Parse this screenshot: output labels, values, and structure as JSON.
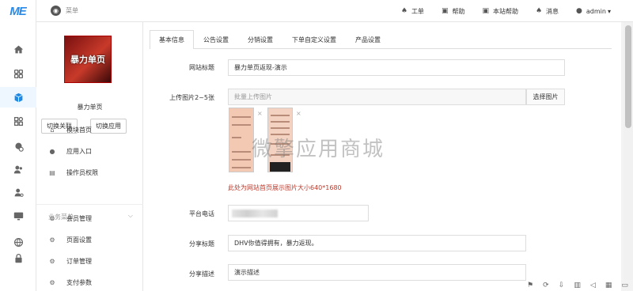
{
  "rail": {
    "logo": "ME",
    "items": [
      {
        "name": "home-icon",
        "glyph": "home"
      },
      {
        "name": "grid-icon",
        "glyph": "grid"
      },
      {
        "name": "cube-icon",
        "glyph": "cube",
        "active": true
      },
      {
        "name": "apps-icon",
        "glyph": "apps"
      },
      {
        "name": "layers-icon",
        "glyph": "layers"
      },
      {
        "name": "users-icon",
        "glyph": "users"
      },
      {
        "name": "user-settings-icon",
        "glyph": "user"
      },
      {
        "name": "monitor-icon",
        "glyph": "monitor"
      },
      {
        "name": "globe-icon",
        "glyph": "globe"
      },
      {
        "name": "lock-icon",
        "glyph": "lock"
      }
    ]
  },
  "topbar": {
    "menu_label": "菜单",
    "items": [
      {
        "name": "ticket",
        "label": "工单",
        "icon": "bell-icon"
      },
      {
        "name": "help",
        "label": "帮助",
        "icon": "book-icon"
      },
      {
        "name": "site-help",
        "label": "本站帮助",
        "icon": "book-icon"
      },
      {
        "name": "messages",
        "label": "消息",
        "icon": "bell-icon"
      },
      {
        "name": "user",
        "label": "admin",
        "icon": "user-icon"
      }
    ]
  },
  "sidebar": {
    "thumb_text": "暴力单页",
    "app_name": "暴力单页",
    "switch_link": "切换关联",
    "switch_app": "切换应用",
    "nav": [
      {
        "label": "模块首页",
        "icon": "home-icon"
      },
      {
        "label": "应用入口",
        "icon": "chat-icon"
      },
      {
        "label": "操作员权限",
        "icon": "document-icon"
      }
    ],
    "group_title": "业务菜单",
    "biz": [
      {
        "label": "会员管理",
        "icon": "gear-icon"
      },
      {
        "label": "页面设置",
        "icon": "gear-icon"
      },
      {
        "label": "订单管理",
        "icon": "gear-icon"
      },
      {
        "label": "支付参数",
        "icon": "gear-icon"
      }
    ]
  },
  "tabs": [
    {
      "label": "基本信息",
      "active": true
    },
    {
      "label": "公告设置",
      "active": false
    },
    {
      "label": "分销设置",
      "active": false
    },
    {
      "label": "下单自定义设置",
      "active": false
    },
    {
      "label": "产品设置",
      "active": false
    }
  ],
  "form": {
    "site_title_label": "网站标题",
    "site_title_value": "暴力单页返现-演示",
    "upload_label": "上传图片2~5张",
    "upload_placeholder": "批量上传图片",
    "upload_button": "选择图片",
    "upload_hint": "此处为网站首页展示图片大小640*1680",
    "remove_glyph": "×",
    "phone_label": "平台电话",
    "share_title_label": "分享标题",
    "share_title_value": "DHV你值得拥有，暴力返现。",
    "share_desc_label": "分享描述",
    "share_desc_value": "演示描述"
  },
  "watermark": "微擎应用商城"
}
